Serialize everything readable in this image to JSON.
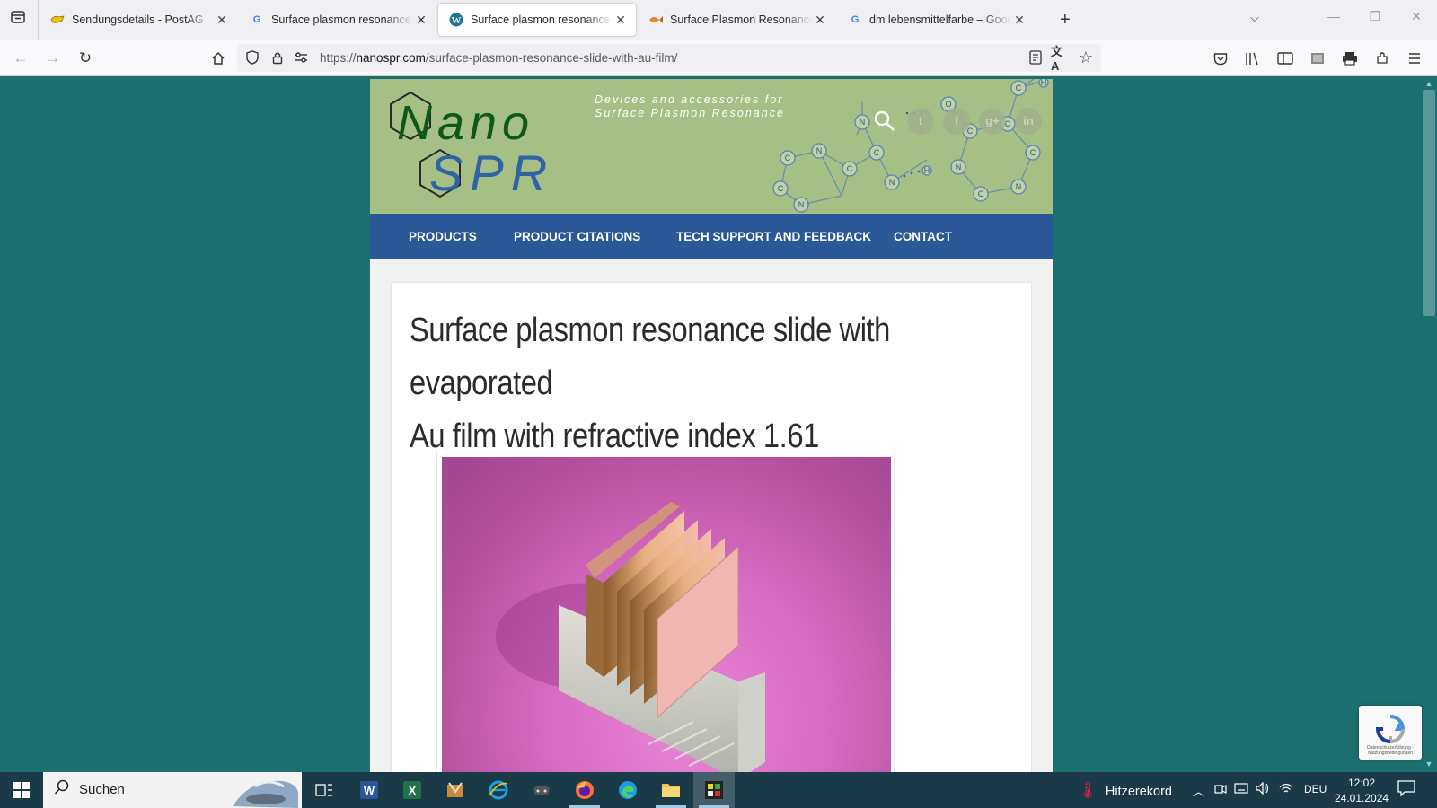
{
  "browser": {
    "tabs": [
      {
        "title": "Sendungsdetails - PostAG",
        "favicon": "postag-horn-icon",
        "active": false
      },
      {
        "title": "Surface plasmon resonance slid",
        "favicon": "google-g-icon",
        "active": false
      },
      {
        "title": "Surface plasmon resonance slid",
        "favicon": "wordpress-icon",
        "active": true
      },
      {
        "title": "Surface Plasmon Resonance po",
        "favicon": "fish-icon",
        "active": false
      },
      {
        "title": "dm lebensmittelfarbe – Google",
        "favicon": "google-g-icon",
        "active": false
      }
    ],
    "url_prefix": "https://",
    "url_domain": "nanospr.com",
    "url_path": "/surface-plasmon-resonance-slide-with-au-film/"
  },
  "site": {
    "logo_top": "Nano",
    "logo_bottom": "SPR",
    "tagline_1": "Devices and accessories for",
    "tagline_2": "Surface Plasmon Resonance",
    "nav": [
      "PRODUCTS",
      "PRODUCT CITATIONS",
      "TECH SUPPORT AND FEEDBACK",
      "CONTACT"
    ],
    "post_title_line1": "Surface plasmon resonance slide with evaporated",
    "post_title_line2": "Au film with refractive index 1.61",
    "recaptcha_text": "Datenschutzerklärung - Nutzungsbedingungen"
  },
  "taskbar": {
    "search_label": "Suchen",
    "weather": "Hitzerekord",
    "lang": "DEU",
    "time": "12:02",
    "date": "24.01.2024"
  },
  "colors": {
    "page_bg": "#1c7070",
    "header_bg": "#a5bf85",
    "nav_bg": "#2b5896",
    "logo_green": "#0d5a17",
    "logo_blue": "#2f63a6"
  }
}
